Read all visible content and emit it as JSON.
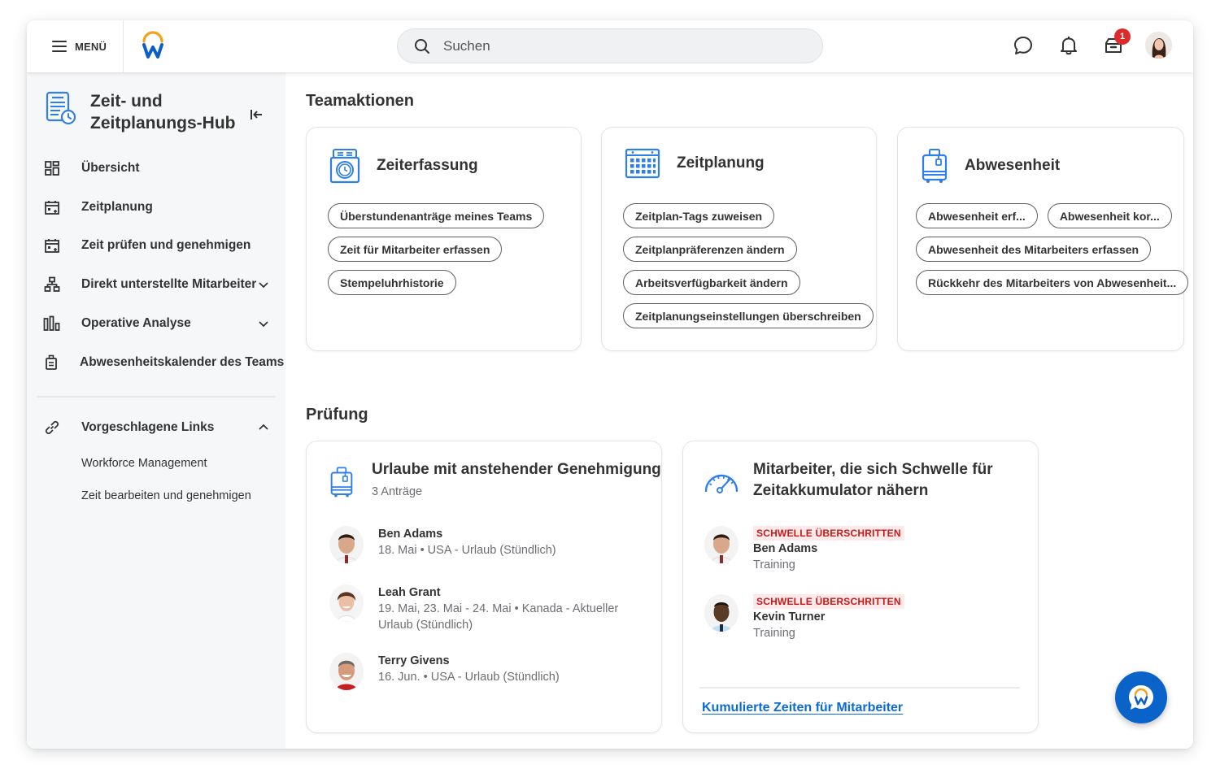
{
  "topbar": {
    "menu_label": "MENÜ",
    "search_placeholder": "Suchen",
    "inbox_badge_count": "1",
    "icons": [
      "menu-icon",
      "workday-logo",
      "search-icon",
      "chat-icon",
      "bell-icon",
      "inbox-icon",
      "user-avatar"
    ]
  },
  "sidebar": {
    "hub_title": "Zeit- und Zeitplanungs-Hub",
    "items": [
      {
        "label": "Übersicht",
        "icon": "dashboard-icon"
      },
      {
        "label": "Zeitplanung",
        "icon": "calendar-icon"
      },
      {
        "label": "Zeit prüfen und genehmigen",
        "icon": "calendar-check-icon"
      },
      {
        "label": "Direkt unterstellte Mitarbeiter",
        "icon": "org-chart-icon",
        "expandable": true
      },
      {
        "label": "Operative Analyse",
        "icon": "bar-chart-icon",
        "expandable": true
      },
      {
        "label": "Abwesenheitskalender des Teams",
        "icon": "suitcase-icon"
      }
    ],
    "suggested": {
      "label": "Vorgeschlagene Links",
      "icon": "link-icon",
      "expanded": true,
      "links": [
        "Workforce Management",
        "Zeit bearbeiten und genehmigen"
      ]
    }
  },
  "main": {
    "team_actions_title": "Teamaktionen",
    "cards": [
      {
        "title": "Zeiterfassung",
        "icon": "time-clock-icon",
        "actions": [
          "Überstundenanträge meines Teams",
          "Zeit für Mitarbeiter erfassen",
          "Stempeluhrhistorie"
        ]
      },
      {
        "title": "Zeitplanung",
        "icon": "calendar-grid-icon",
        "actions": [
          "Zeitplan-Tags zuweisen",
          "Zeitplanpräferenzen ändern",
          "Arbeitsverfügbarkeit ändern",
          "Zeitplanungseinstellungen überschreiben"
        ]
      },
      {
        "title": "Abwesenheit",
        "icon": "luggage-icon",
        "actions": [
          "Abwesenheit erf...",
          "Abwesenheit kor...",
          "Abwesenheit des Mitarbeiters erfassen",
          "Rückkehr des Mitarbeiters von Abwesenheit..."
        ]
      }
    ],
    "review_title": "Prüfung",
    "pending_leave": {
      "title": "Urlaube mit anstehender Genehmigung",
      "count_label": "3 Anträge",
      "people": [
        {
          "name": "Ben Adams",
          "detail": "18. Mai • USA - Urlaub (Stündlich)"
        },
        {
          "name": "Leah Grant",
          "detail": "19. Mai, 23. Mai - 24. Mai • Kanada - Aktueller Urlaub (Stündlich)"
        },
        {
          "name": "Terry Givens",
          "detail": "16. Jun. • USA - Urlaub (Stündlich)"
        }
      ]
    },
    "threshold": {
      "title": "Mitarbeiter, die sich Schwelle für Zeitakkumulator nähern",
      "people": [
        {
          "status": "SCHWELLE ÜBERSCHRITTEN",
          "name": "Ben Adams",
          "detail": "Training"
        },
        {
          "status": "SCHWELLE ÜBERSCHRITTEN",
          "name": "Kevin Turner",
          "detail": "Training"
        }
      ],
      "link": "Kumulierte Zeiten für Mitarbeiter"
    }
  },
  "colors": {
    "accent_blue": "#0b6bd6",
    "icon_blue": "#2f7fea",
    "logo_orange": "#f5a01a",
    "alert_red": "#c41b1b",
    "badge_red": "#de2a2a"
  }
}
